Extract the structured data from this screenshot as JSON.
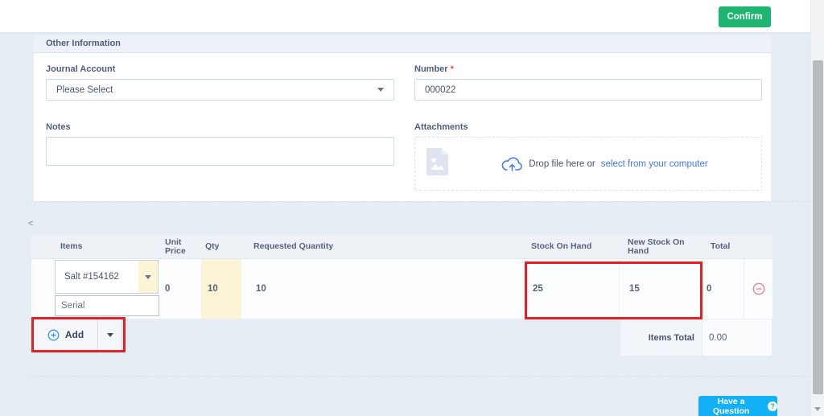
{
  "topbar": {
    "confirm_label": "Confirm"
  },
  "other_info": {
    "title": "Other Information",
    "journal_account": {
      "label": "Journal Account",
      "selected": "Please Select"
    },
    "number": {
      "label": "Number",
      "required_mark": "*",
      "value": "000022"
    },
    "notes": {
      "label": "Notes",
      "value": ""
    },
    "attachments": {
      "label": "Attachments",
      "drop_text": "Drop file here or",
      "select_link": "select from your computer"
    }
  },
  "items_table": {
    "collapse_icon": "<",
    "headers": [
      "Items",
      "Unit Price",
      "Qty",
      "Requested Quantity",
      "Stock On Hand",
      "New Stock On Hand",
      "Total"
    ],
    "row": {
      "item": "Salt #154162",
      "serial_placeholder": "Serial",
      "unit_price": "0",
      "qty": "10",
      "requested_qty": "10",
      "stock_on_hand": "25",
      "new_stock_on_hand": "15",
      "total": "0"
    },
    "add_label": "Add",
    "items_total_label": "Items Total",
    "items_total_value": "0.00"
  },
  "help_button": {
    "label": "Have a Question",
    "icon_text": "?"
  },
  "colors": {
    "confirm_green": "#1db570",
    "annotation_red": "#e52127",
    "link_blue": "#3e78f8",
    "help_cyan": "#12b0f6",
    "qty_yellow": "#fcf4d6"
  }
}
